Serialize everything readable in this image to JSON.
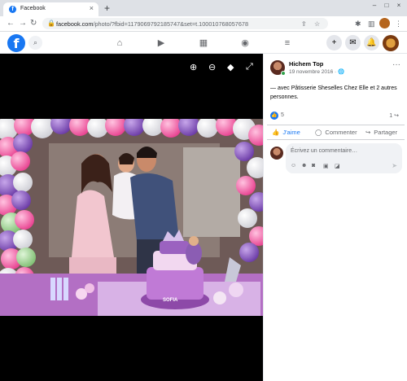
{
  "browser": {
    "tab_title": "Facebook",
    "new_tab": "+",
    "url_host": "facebook.com",
    "url_path": "/photo/?fbid=1179069792185747&set=t.100010768057678"
  },
  "photo_viewer": {
    "caption_text": "SOFIA"
  },
  "post": {
    "author": "Hichem Top",
    "date": "19 novembre 2016 · ",
    "more": "···",
    "caption_prefix": "— avec ",
    "caption_main": "Pâtisserie Sheselles Chez Elle et 2 autres personnes.",
    "like_count": "5",
    "share_count": "1",
    "actions": {
      "like": "J'aime",
      "comment": "Commenter",
      "share": "Partager"
    },
    "comment_placeholder": "Écrivez un commentaire…"
  },
  "colors": {
    "brand": "#1877f2",
    "online": "#31a24c"
  }
}
